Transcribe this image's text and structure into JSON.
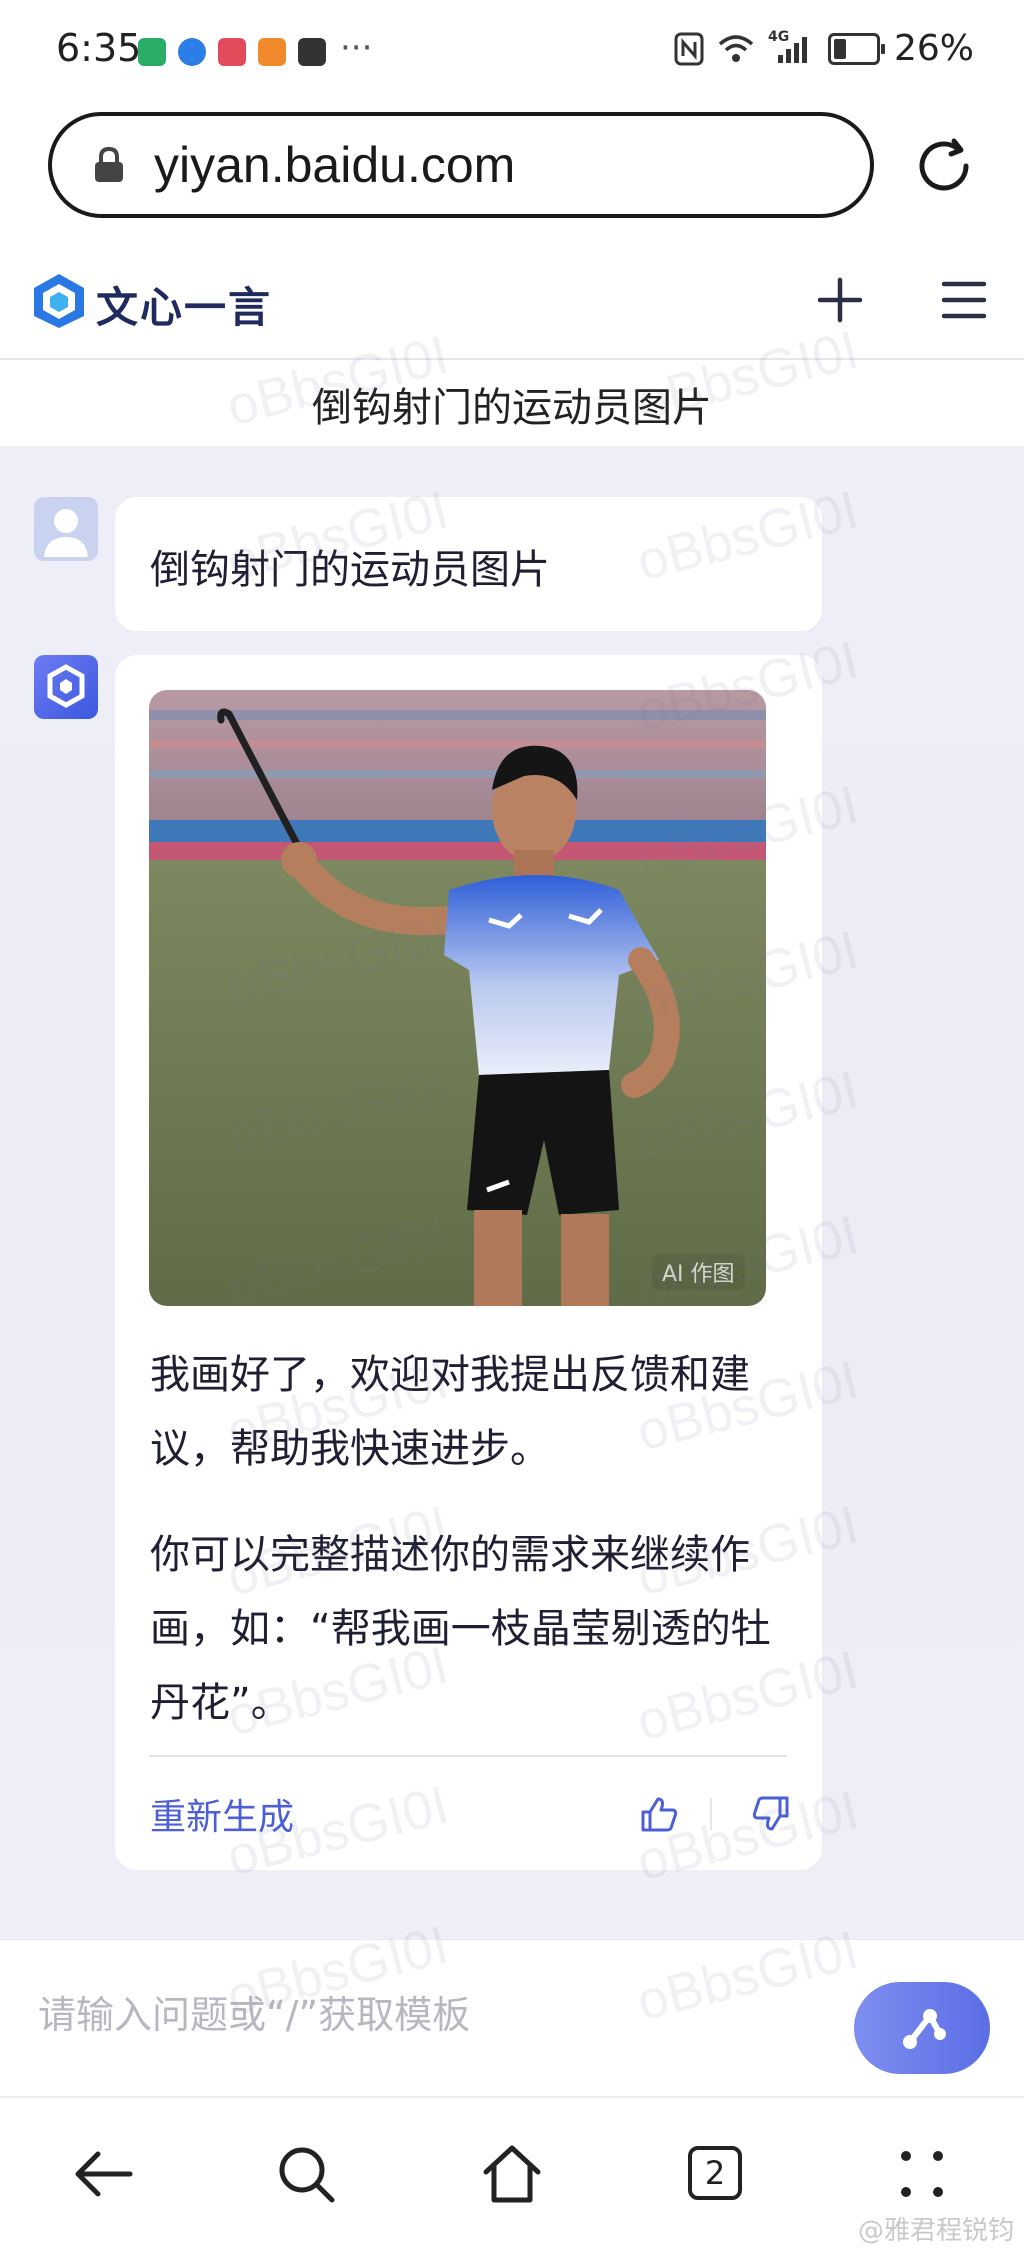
{
  "status_bar": {
    "time": "6:35",
    "more": "···",
    "network_label": "4G",
    "battery_percent": "26%",
    "battery_level": 0.26,
    "app_icons": [
      "wechat-icon",
      "browser-icon",
      "reader-icon",
      "video-icon",
      "mail-icon"
    ]
  },
  "browser": {
    "url": "yiyan.baidu.com",
    "tab_count": "2"
  },
  "app": {
    "logo_text": "文心一言"
  },
  "chat": {
    "title": "倒钩射门的运动员图片",
    "user_message": "倒钩射门的运动员图片",
    "bot": {
      "image_badge": "AI 作图",
      "reply_line_1": "我画好了，欢迎对我提出反馈和建议，帮助我快速进步。",
      "reply_line_2": "你可以完整描述你的需求来继续作画，如：“帮我画一枝晶莹剔透的牡丹花”。",
      "regenerate_label": "重新生成"
    }
  },
  "input": {
    "placeholder": "请输入问题或“/”获取模板"
  },
  "watermark_text": "oBbsGI0I",
  "footer_credit": "@雅君程锐钧",
  "colors": {
    "accent": "#4b5fd6",
    "send_gradient_start": "#7f8ef0",
    "send_gradient_end": "#5b6ee5",
    "chat_background": "#efeff8"
  }
}
